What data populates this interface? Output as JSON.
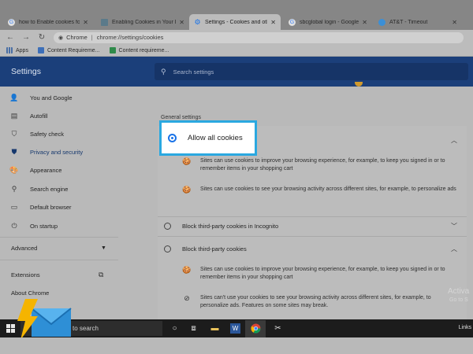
{
  "tabs": [
    {
      "title": "how to Enable cookies for a s",
      "active": false,
      "favicon": "google-icon"
    },
    {
      "title": "Enabling Cookies in Your Bro",
      "active": false,
      "favicon": "page-icon"
    },
    {
      "title": "Settings - Cookies and other",
      "active": true,
      "favicon": "gear-icon"
    },
    {
      "title": "sbcglobal login - Google Sea",
      "active": false,
      "favicon": "google-icon"
    },
    {
      "title": "AT&T - Timeout",
      "active": false,
      "favicon": "att-icon"
    }
  ],
  "toolbar": {
    "scheme": "Chrome",
    "url": "chrome://settings/cookies"
  },
  "bookmarks": [
    {
      "label": "Apps",
      "icon": "apps-grid-icon"
    },
    {
      "label": "Content Requireme...",
      "icon": "docs-icon"
    },
    {
      "label": "Content requireme...",
      "icon": "sheets-icon"
    }
  ],
  "header": {
    "title": "Settings",
    "search_placeholder": "Search settings"
  },
  "sidebar": {
    "items": [
      {
        "label": "You and Google",
        "icon": "person-icon",
        "active": false
      },
      {
        "label": "Autofill",
        "icon": "clipboard-icon",
        "active": false
      },
      {
        "label": "Safety check",
        "icon": "shield-check-icon",
        "active": false
      },
      {
        "label": "Privacy and security",
        "icon": "shield-icon",
        "active": true
      },
      {
        "label": "Appearance",
        "icon": "palette-icon",
        "active": false
      },
      {
        "label": "Search engine",
        "icon": "search-icon",
        "active": false
      },
      {
        "label": "Default browser",
        "icon": "browser-icon",
        "active": false
      },
      {
        "label": "On startup",
        "icon": "power-icon",
        "active": false
      }
    ],
    "advanced": "Advanced",
    "extensions": "Extensions",
    "about": "About Chrome"
  },
  "content": {
    "section_heading": "General settings",
    "allow_all": {
      "label": "Allow all cookies",
      "selected": true,
      "details": [
        "Sites can use cookies to improve your browsing experience, for example, to keep you signed in or to remember items in your shopping cart",
        "Sites can use cookies to see your browsing activity across different sites, for example, to personalize ads"
      ]
    },
    "block_incognito": {
      "label": "Block third-party cookies in Incognito",
      "selected": false
    },
    "block_third_party": {
      "label": "Block third-party cookies",
      "selected": false,
      "details": [
        "Sites can use cookies to improve your browsing experience, for example, to keep you signed in or to remember items in your shopping cart",
        "Sites can't use your cookies to see your browsing activity across different sites, for example, to personalize ads. Features on some sites may break."
      ]
    }
  },
  "watermark": {
    "line1": "Activa",
    "line2": "Go to S"
  },
  "taskbar": {
    "search_text": "to search",
    "links": "Links"
  },
  "colors": {
    "header_bg": "#1b3f7a",
    "highlight_border": "#2aa8e0",
    "radio_selected": "#1a73e8",
    "active_nav": "#16386d"
  }
}
